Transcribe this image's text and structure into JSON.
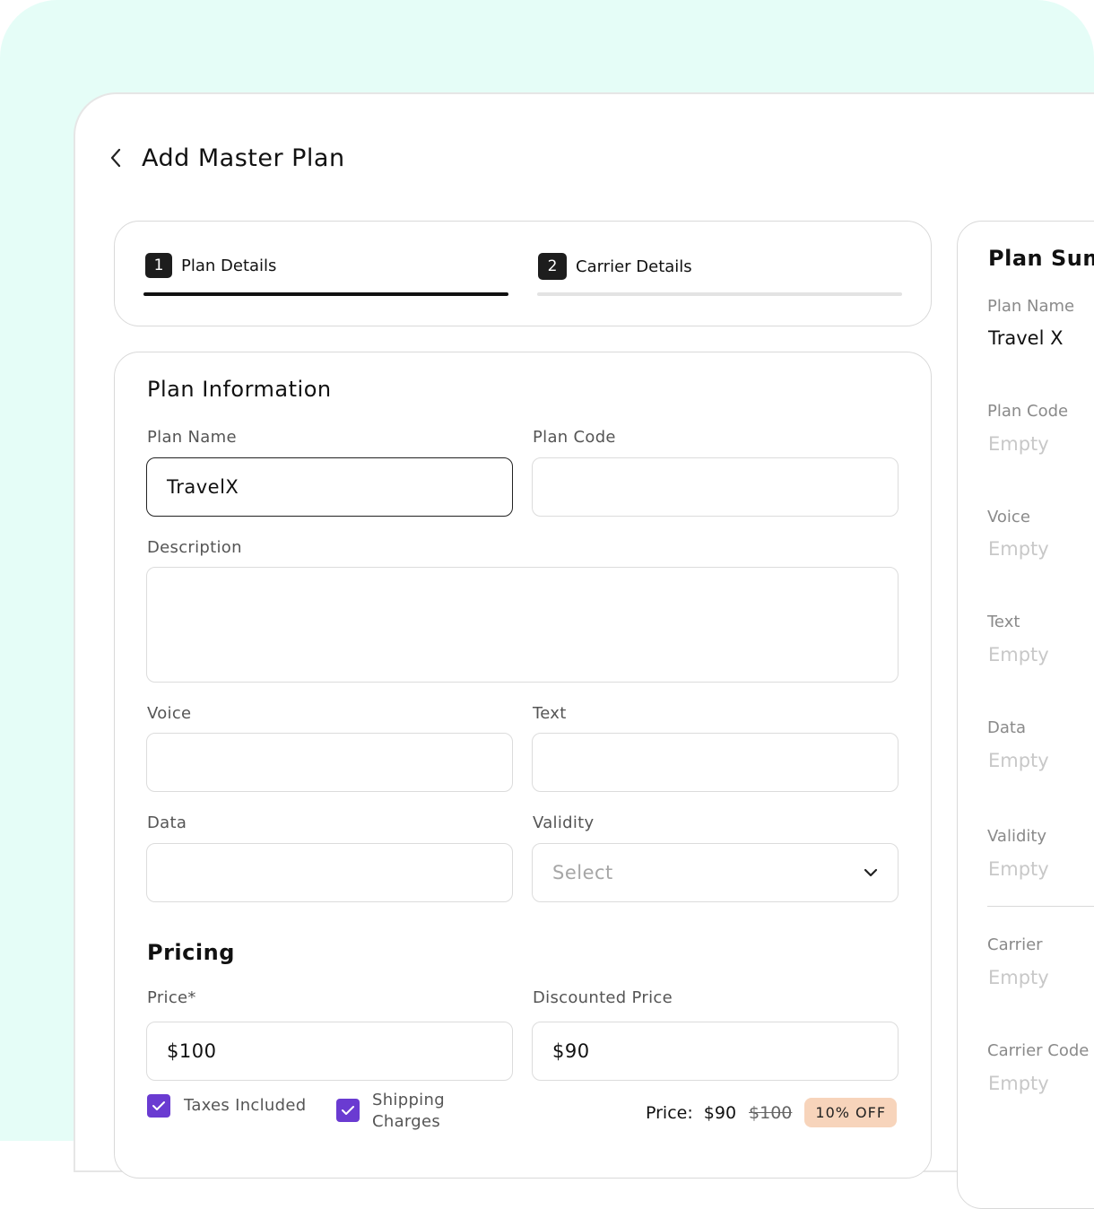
{
  "header": {
    "title": "Add Master Plan"
  },
  "steps": [
    {
      "number": "1",
      "label": "Plan Details",
      "active": true
    },
    {
      "number": "2",
      "label": "Carrier Details",
      "active": false
    }
  ],
  "plan_information": {
    "title": "Plan Information",
    "plan_name": {
      "label": "Plan Name",
      "value": "TravelX"
    },
    "plan_code": {
      "label": "Plan Code",
      "value": ""
    },
    "description": {
      "label": "Description",
      "value": ""
    },
    "voice": {
      "label": "Voice",
      "value": ""
    },
    "text": {
      "label": "Text",
      "value": ""
    },
    "data": {
      "label": "Data",
      "value": ""
    },
    "validity": {
      "label": "Validity",
      "selected": "Select"
    }
  },
  "pricing": {
    "title": "Pricing",
    "price": {
      "label": "Price*",
      "value": "$100"
    },
    "discounted_price": {
      "label": "Discounted Price",
      "value": "$90"
    },
    "taxes_included": {
      "label": "Taxes Included",
      "checked": true
    },
    "shipping_charges": {
      "label_line1": "Shipping",
      "label_line2": "Charges",
      "checked": true
    },
    "summary": {
      "prefix": "Price:",
      "current": "$90",
      "original": "$100",
      "discount_badge": "10% OFF"
    }
  },
  "plan_summary": {
    "title": "Plan Summary",
    "items": [
      {
        "label": "Plan Name",
        "value": "Travel X"
      },
      {
        "label": "Plan Code",
        "value": "Empty"
      },
      {
        "label": "Voice",
        "value": "Empty"
      },
      {
        "label": "Text",
        "value": "Empty"
      },
      {
        "label": "Data",
        "value": "Empty"
      },
      {
        "label": "Validity",
        "value": "Empty"
      },
      {
        "label": "Carrier",
        "value": "Empty"
      },
      {
        "label": "Carrier Code",
        "value": "Empty"
      }
    ]
  },
  "colors": {
    "background": "#e5fdf7",
    "accent_checkbox": "#6a3bd1",
    "discount_badge": "#f7d4bb",
    "step_active": "#111111",
    "step_inactive": "#e3e3e3"
  },
  "icons": {
    "back": "chevron-left-icon",
    "dropdown": "chevron-down-icon",
    "check": "check-icon"
  }
}
